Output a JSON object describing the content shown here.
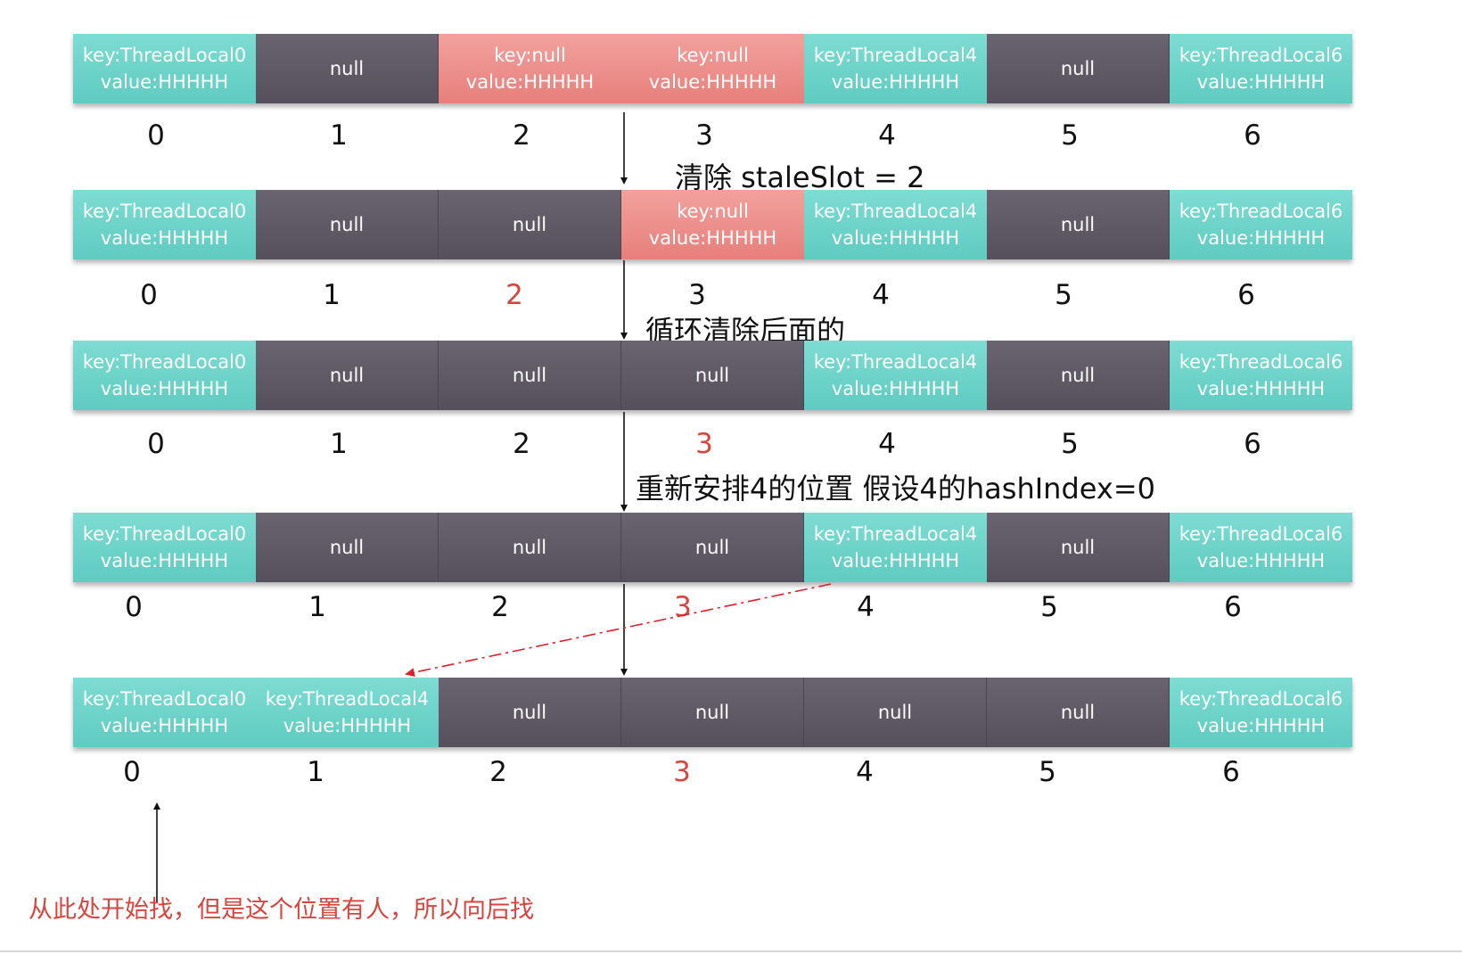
{
  "rows": [
    {
      "cells": [
        {
          "kind": "teal",
          "key": "key:ThreadLocal0",
          "value": "value:HHHHH"
        },
        {
          "kind": "dark",
          "text": "null"
        },
        {
          "kind": "red",
          "key": "key:null",
          "value": "value:HHHHH"
        },
        {
          "kind": "red",
          "key": "key:null",
          "value": "value:HHHHH"
        },
        {
          "kind": "teal",
          "key": "key:ThreadLocal4",
          "value": "value:HHHHH"
        },
        {
          "kind": "dark",
          "text": "null"
        },
        {
          "kind": "teal",
          "key": "key:ThreadLocal6",
          "value": "value:HHHHH"
        }
      ],
      "indices": [
        "0",
        "1",
        "2",
        "3",
        "4",
        "5",
        "6"
      ],
      "highlight": null,
      "caption": "清除 staleSlot = 2"
    },
    {
      "cells": [
        {
          "kind": "teal",
          "key": "key:ThreadLocal0",
          "value": "value:HHHHH"
        },
        {
          "kind": "dark",
          "text": "null"
        },
        {
          "kind": "dark",
          "text": "null"
        },
        {
          "kind": "red",
          "key": "key:null",
          "value": "value:HHHHH"
        },
        {
          "kind": "teal",
          "key": "key:ThreadLocal4",
          "value": "value:HHHHH"
        },
        {
          "kind": "dark",
          "text": "null"
        },
        {
          "kind": "teal",
          "key": "key:ThreadLocal6",
          "value": "value:HHHHH"
        }
      ],
      "indices": [
        "0",
        "1",
        "2",
        "3",
        "4",
        "5",
        "6"
      ],
      "highlight": 2,
      "caption": "循环清除后面的"
    },
    {
      "cells": [
        {
          "kind": "teal",
          "key": "key:ThreadLocal0",
          "value": "value:HHHHH"
        },
        {
          "kind": "dark",
          "text": "null"
        },
        {
          "kind": "dark",
          "text": "null"
        },
        {
          "kind": "dark",
          "text": "null"
        },
        {
          "kind": "teal",
          "key": "key:ThreadLocal4",
          "value": "value:HHHHH"
        },
        {
          "kind": "dark",
          "text": "null"
        },
        {
          "kind": "teal",
          "key": "key:ThreadLocal6",
          "value": "value:HHHHH"
        }
      ],
      "indices": [
        "0",
        "1",
        "2",
        "3",
        "4",
        "5",
        "6"
      ],
      "highlight": 3,
      "caption": "重新安排4的位置 假设4的hashIndex=0"
    },
    {
      "cells": [
        {
          "kind": "teal",
          "key": "key:ThreadLocal0",
          "value": "value:HHHHH"
        },
        {
          "kind": "dark",
          "text": "null"
        },
        {
          "kind": "dark",
          "text": "null"
        },
        {
          "kind": "dark",
          "text": "null"
        },
        {
          "kind": "teal",
          "key": "key:ThreadLocal4",
          "value": "value:HHHHH"
        },
        {
          "kind": "dark",
          "text": "null"
        },
        {
          "kind": "teal",
          "key": "key:ThreadLocal6",
          "value": "value:HHHHH"
        }
      ],
      "indices": [
        "0",
        "1",
        "2",
        "3",
        "4",
        "5",
        "6"
      ],
      "highlight": 3,
      "caption": ""
    },
    {
      "cells": [
        {
          "kind": "teal",
          "key": "key:ThreadLocal0",
          "value": "value:HHHHH"
        },
        {
          "kind": "teal",
          "key": "key:ThreadLocal4",
          "value": "value:HHHHH"
        },
        {
          "kind": "dark",
          "text": "null"
        },
        {
          "kind": "dark",
          "text": "null"
        },
        {
          "kind": "dark",
          "text": "null"
        },
        {
          "kind": "dark",
          "text": "null"
        },
        {
          "kind": "teal",
          "key": "key:ThreadLocal6",
          "value": "value:HHHHH"
        }
      ],
      "indices": [
        "0",
        "1",
        "2",
        "3",
        "4",
        "5",
        "6"
      ],
      "highlight": 3,
      "caption": ""
    }
  ],
  "note": "从此处开始找，但是这个位置有人，所以向后找",
  "colors": {
    "teal": "#6dd3c9",
    "dark": "#5e5866",
    "red": "#ec8e8a",
    "highlight_text": "#d9443f",
    "arrow": "#111111",
    "dash_arrow": "#e0202a"
  }
}
